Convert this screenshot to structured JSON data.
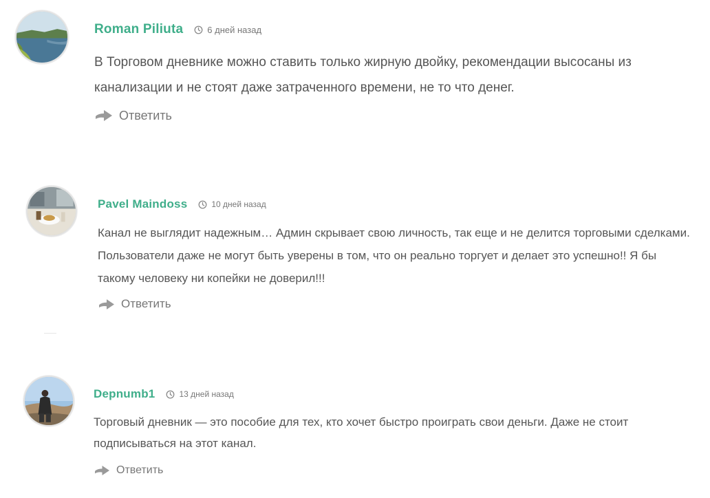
{
  "comments": [
    {
      "author": "Roman Piliuta",
      "date": "6 дней назад",
      "text": "В Торговом дневнике можно ставить только жирную двойку, рекомендации высосаны из канализации и не стоят даже затраченного времени, не то что денег.",
      "reply_label": "Ответить",
      "avatar_icon": "lake-landscape-photo"
    },
    {
      "author": "Pavel Maindoss",
      "date": "10 дней назад",
      "text": "Канал не выглядит надежным… Админ скрывает свою личность, так еще и не делится торговыми сделками. Пользователи даже не могут быть уверены в том, что он реально торгует и делает это успешно!! Я бы такому человеку ни копейки не доверил!!!",
      "reply_label": "Ответить",
      "avatar_icon": "cafe-table-photo"
    },
    {
      "author": "Depnumb1",
      "date": "13 дней назад",
      "text": "Торговый дневник — это пособие для тех, кто хочет быстро проиграть свои деньги. Даже не стоит подписываться на этот канал.",
      "reply_label": "Ответить",
      "avatar_icon": "person-outdoors-photo"
    }
  ],
  "colors": {
    "author": "#3fae8a",
    "text": "#555555",
    "meta": "#777777",
    "icon": "#999999"
  }
}
